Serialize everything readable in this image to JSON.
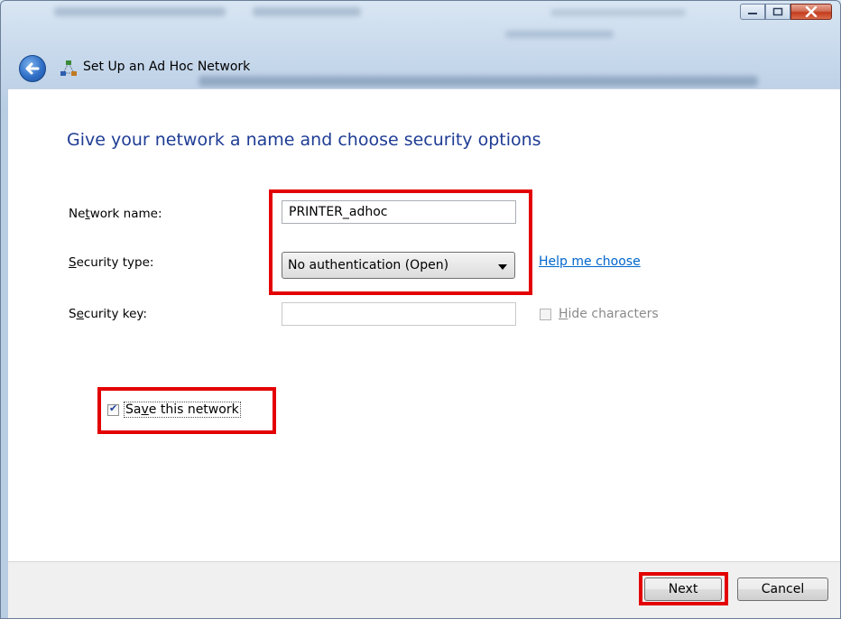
{
  "window": {
    "title": "Set Up an Ad Hoc Network",
    "controls": {
      "minimize": "minimize-icon",
      "maximize": "maximize-icon",
      "close": "close-icon"
    }
  },
  "heading": "Give your network a name and choose security options",
  "form": {
    "network_name": {
      "label_pre": "Ne",
      "label_accel": "t",
      "label_post": "work name:",
      "value": "PRINTER_adhoc"
    },
    "security_type": {
      "label_pre": "",
      "label_accel": "S",
      "label_post": "ecurity type:",
      "value": "No authentication (Open)"
    },
    "security_key": {
      "label_pre": "S",
      "label_accel": "e",
      "label_post": "curity key:",
      "value": ""
    },
    "help_link": "Help me choose",
    "hide_characters": {
      "label_accel": "H",
      "label_post": "ide characters",
      "checked": false
    },
    "save_network": {
      "label_pre": "Sa",
      "label_accel": "v",
      "label_post": "e this network",
      "checked": true
    }
  },
  "footer": {
    "next_label": "Next",
    "cancel_label": "Cancel"
  },
  "colors": {
    "heading": "#1e3c94",
    "link": "#0066cc",
    "highlight": "#e30000",
    "footer_bg": "#f0f0f0"
  }
}
